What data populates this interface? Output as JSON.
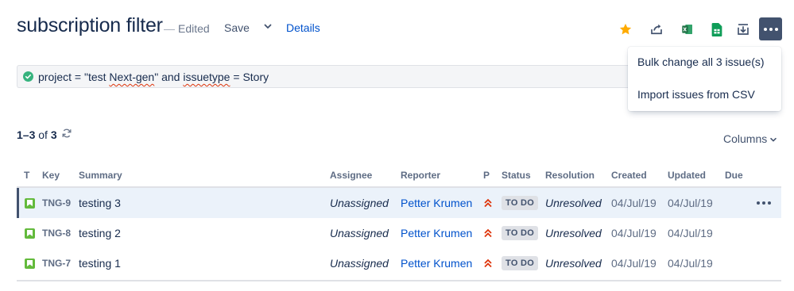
{
  "header": {
    "title": "subscription filter",
    "edited_dash": "—",
    "edited_label": "Edited",
    "save_label": "Save",
    "details_label": "Details",
    "toolbar_icons": [
      "star-icon",
      "share-icon",
      "excel-export-icon",
      "google-sheets-icon",
      "export-icon",
      "more-icon"
    ],
    "colors": {
      "star": "#ffab00",
      "excel": "#1e7145",
      "sheets": "#0f9d58",
      "accent": "#42526e",
      "link": "#0052cc"
    }
  },
  "query": {
    "text_before": "project = \"test ",
    "text_word1": "Next-gen",
    "text_middle": "\" and ",
    "text_word2": "issuetype",
    "text_after": " = Story",
    "status_icon": "check-circle-icon"
  },
  "menu": {
    "items": [
      "Bulk change all 3 issue(s)",
      "Import issues from CSV"
    ]
  },
  "results": {
    "range": "1–3",
    "of_label": "of",
    "total": "3",
    "columns_label": "Columns"
  },
  "table": {
    "headers": [
      "T",
      "Key",
      "Summary",
      "Assignee",
      "Reporter",
      "P",
      "Status",
      "Resolution",
      "Created",
      "Updated",
      "Due"
    ],
    "rows": [
      {
        "key": "TNG-9",
        "summary": "testing 3",
        "assignee": "Unassigned",
        "reporter": "Petter Krumen",
        "status": "TO DO",
        "resolution": "Unresolved",
        "created": "04/Jul/19",
        "updated": "04/Jul/19",
        "due": ""
      },
      {
        "key": "TNG-8",
        "summary": "testing 2",
        "assignee": "Unassigned",
        "reporter": "Petter Krumen",
        "status": "TO DO",
        "resolution": "Unresolved",
        "created": "04/Jul/19",
        "updated": "04/Jul/19",
        "due": ""
      },
      {
        "key": "TNG-7",
        "summary": "testing 1",
        "assignee": "Unassigned",
        "reporter": "Petter Krumen",
        "status": "TO DO",
        "resolution": "Unresolved",
        "created": "04/Jul/19",
        "updated": "04/Jul/19",
        "due": ""
      }
    ]
  }
}
